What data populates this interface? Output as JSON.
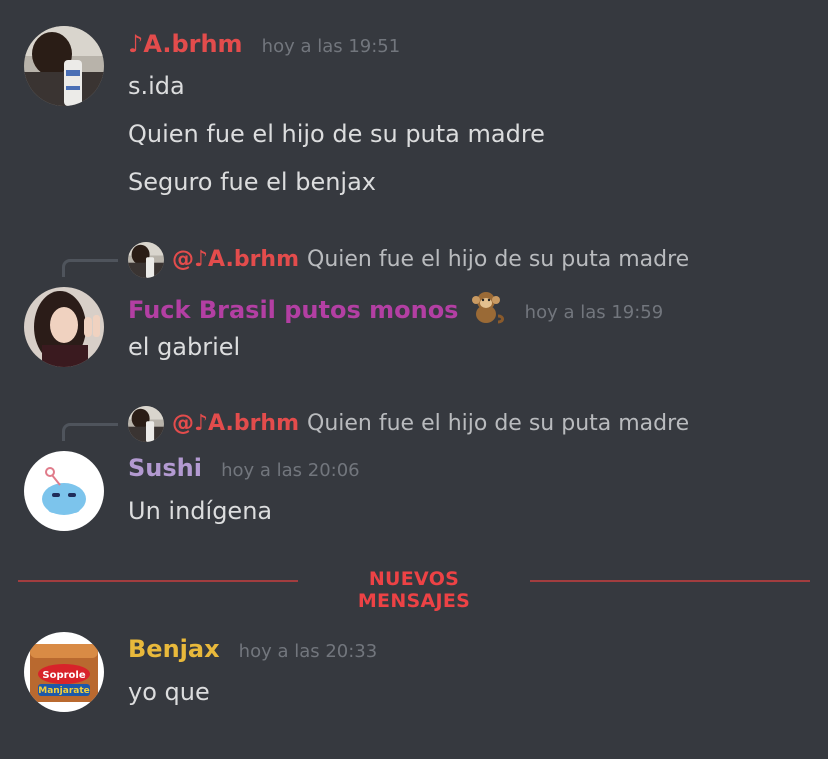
{
  "colors": {
    "background": "#36393f",
    "username_abrhm": "#e34c4c",
    "username_fuck": "#b33fa3",
    "username_sushi": "#b39ad1",
    "username_benjax": "#e9b93b",
    "timestamp": "#72767d",
    "text": "#dcddde",
    "new_messages": "#ed4245"
  },
  "messages": [
    {
      "username": "♪A.brhm",
      "timestamp": "hoy a las 19:51",
      "lines": [
        "s.ida",
        "Quien fue el hijo de su puta madre",
        "Seguro fue el benjax"
      ]
    },
    {
      "reply": {
        "mention": "@♪A.brhm",
        "preview": "Quien fue el hijo de su puta madre"
      },
      "username": "Fuck Brasil putos monos",
      "emoji": "monkey-icon",
      "timestamp": "hoy a las 19:59",
      "lines": [
        "el gabriel"
      ]
    },
    {
      "reply": {
        "mention": "@♪A.brhm",
        "preview": "Quien fue el hijo de su puta madre"
      },
      "username": "Sushi",
      "timestamp": "hoy a las 20:06",
      "lines": [
        "Un indígena"
      ]
    },
    {
      "username": "Benjax",
      "timestamp": "hoy a las 20:33",
      "lines": [
        "yo que"
      ]
    }
  ],
  "divider": {
    "label": "NUEVOS MENSAJES"
  },
  "avatar_texts": {
    "benjax_brand": "Soprole",
    "benjax_product": "Manjarate"
  }
}
